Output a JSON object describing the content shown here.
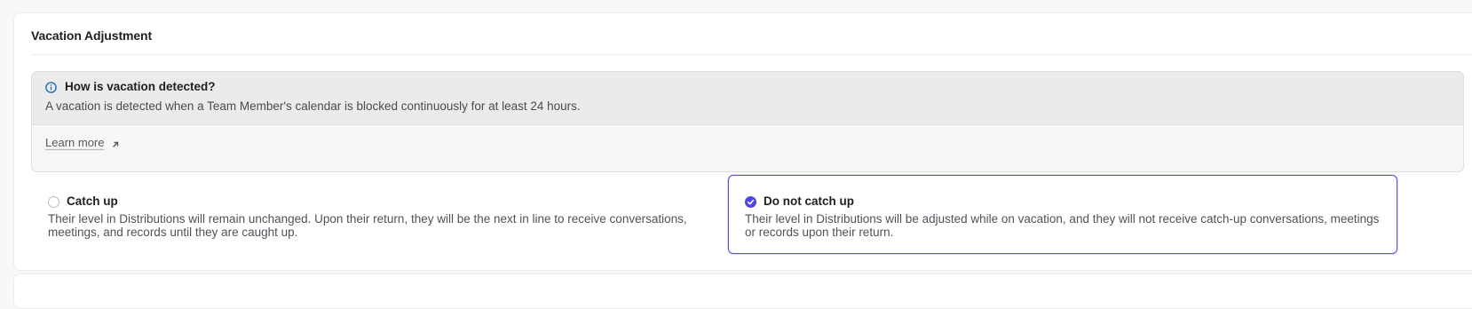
{
  "section": {
    "title": "Vacation Adjustment"
  },
  "info": {
    "icon": "info-icon",
    "heading": "How is vacation detected?",
    "text": "A vacation is detected when a Team Member's calendar is blocked continuously for at least 24 hours.",
    "learn_more": "Learn more",
    "learn_more_icon": "arrow-up-right-icon"
  },
  "options": [
    {
      "title": "Catch up",
      "description": "Their level in Distributions will remain unchanged. Upon their return, they will be the next in line to receive conversations, meetings, and records until they are caught up.",
      "selected": false
    },
    {
      "title": "Do not catch up",
      "description": "Their level in Distributions will be adjusted while on vacation, and they will not receive catch-up conversations, meetings or records upon their return.",
      "selected": true
    }
  ],
  "colors": {
    "accent": "#4f46e5",
    "info_icon": "#1f6fb8"
  }
}
